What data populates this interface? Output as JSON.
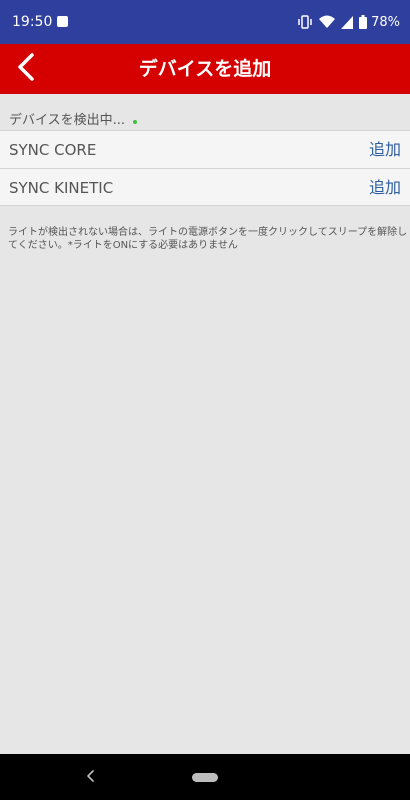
{
  "status_bar": {
    "time": "19:50",
    "battery": "78%"
  },
  "app_bar": {
    "title": "デバイスを追加"
  },
  "scan": {
    "status": "デバイスを検出中..."
  },
  "devices": [
    {
      "name": "SYNC CORE",
      "action": "追加"
    },
    {
      "name": "SYNC KINETIC",
      "action": "追加"
    }
  ],
  "help": {
    "text": "ライトが検出されない場合は、ライトの電源ボタンを一度クリックしてスリープを解除してください。*ライトをONにする必要はありません"
  },
  "colors": {
    "status_bar": "#2f3f9e",
    "app_bar": "#d50000",
    "link": "#2e5e9e",
    "background": "#e6e6e6"
  }
}
